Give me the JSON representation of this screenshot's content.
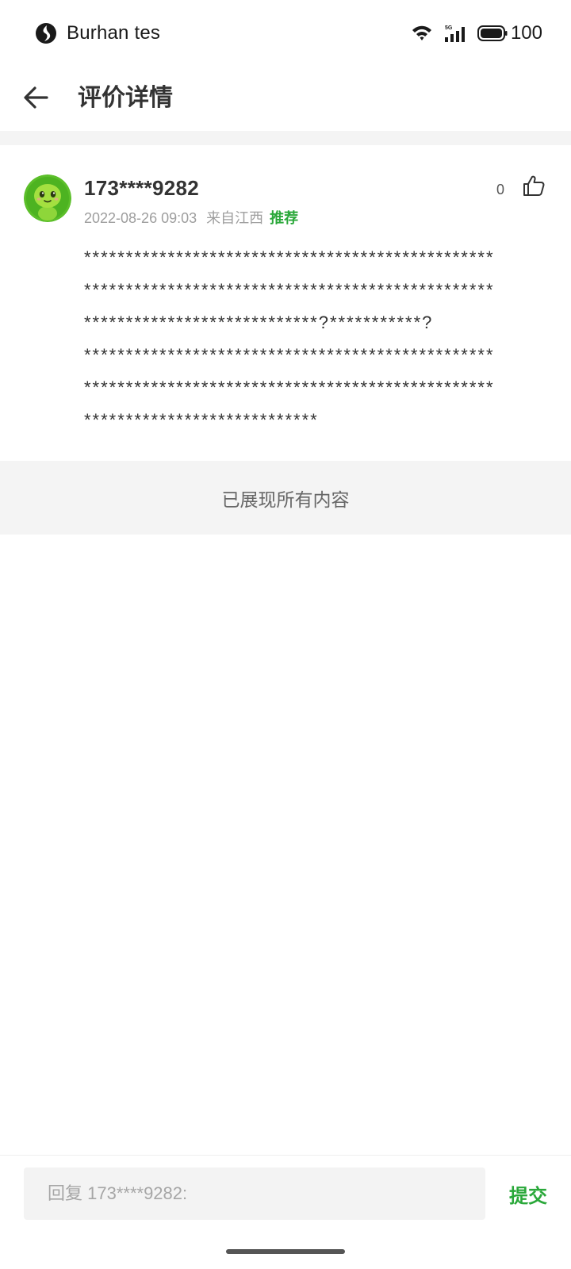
{
  "status_bar": {
    "carrier_text": "Burhan tes",
    "battery_percent": "100",
    "network_badge": "5G",
    "icons": [
      "app-indicator-icon",
      "wifi-icon",
      "cellular-signal-icon",
      "battery-icon"
    ]
  },
  "header": {
    "title": "评价详情",
    "back_icon": "arrow-left-icon"
  },
  "review": {
    "username": "173****9282",
    "datetime": "2022-08-26 09:03",
    "location": "来自江西",
    "tag": "推荐",
    "like_count": "0",
    "like_icon": "thumbs-up-icon",
    "avatar_icon": "green-mascot-avatar",
    "text_lines": [
      "*************************************************",
      "*************************************************",
      "****************************?***********?",
      "*************************************************",
      "*************************************************",
      "****************************"
    ]
  },
  "end_notice": "已展现所有内容",
  "reply": {
    "placeholder": "回复 173****9282:",
    "submit_label": "提交"
  },
  "colors": {
    "accent_green": "#2aa83a",
    "divider_gray": "#f4f4f4",
    "text_dark": "#333333",
    "text_muted": "#9e9e9e"
  }
}
